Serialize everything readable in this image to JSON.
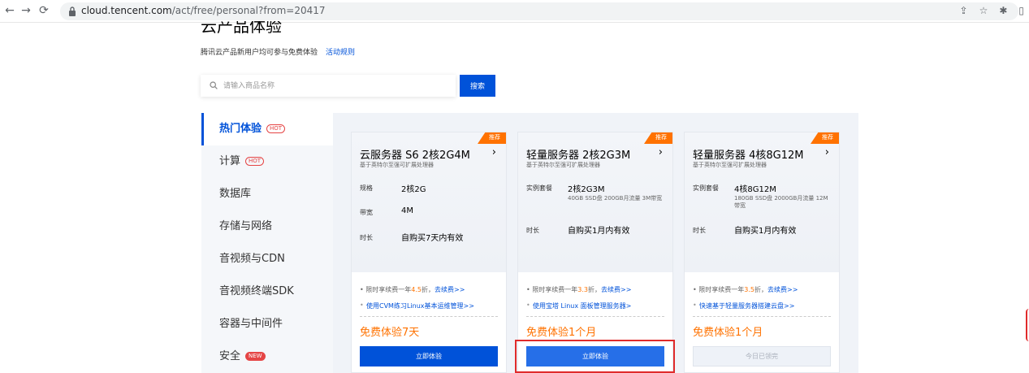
{
  "browser": {
    "url_host": "cloud.tencent.com",
    "url_path": "/act/free/personal?from=20417"
  },
  "page": {
    "title": "云产品体验",
    "subtitle": "腾讯云产品新用户均可参与免费体验",
    "rules_link": "活动规则"
  },
  "search": {
    "placeholder": "请输入商品名称",
    "button": "搜索"
  },
  "sidebar": {
    "items": [
      {
        "label": "热门体验",
        "badge": "HOT"
      },
      {
        "label": "计算",
        "badge": "HOT"
      },
      {
        "label": "数据库"
      },
      {
        "label": "存储与网络"
      },
      {
        "label": "音视频与CDN"
      },
      {
        "label": "音视频终端SDK"
      },
      {
        "label": "容器与中间件"
      },
      {
        "label": "安全",
        "badge": "NEW"
      }
    ]
  },
  "cards": [
    {
      "tag": "推荐",
      "title": "云服务器 S6 2核2G4M",
      "arrow": "›",
      "desc": "基于英特尔至强可扩展处理器",
      "spec1_label": "规格",
      "spec1_value": "2核2G",
      "spec2_label": "带宽",
      "spec2_value": "4M",
      "spec3_label": "时长",
      "spec3_value": "自购买7天内有效",
      "bullet1_pre": "限时享续费一年",
      "bullet1_num": "4.5",
      "bullet1_post": "折，",
      "bullet1_link": "去续费>>",
      "bullet2": "使用CVM练习Linux基本运维管理>>",
      "free": "免费体验7天",
      "button": "立即体验"
    },
    {
      "tag": "推荐",
      "title": "轻量服务器 2核2G3M",
      "arrow": "›",
      "desc": "基于英特尔至强可扩展处理器",
      "spec1_label": "实例套餐",
      "spec1_value": "2核2G3M",
      "spec1_sub": "40GB SSD盘 200GB月流量 3M带宽",
      "spec3_label": "时长",
      "spec3_value": "自购买1月内有效",
      "bullet1_pre": "限时享续费一年",
      "bullet1_num": "3.3",
      "bullet1_post": "折，",
      "bullet1_link": "去续费>>",
      "bullet2": "使用宝塔 Linux 面板管理服务器>",
      "free": "免费体验1个月",
      "button": "立即体验"
    },
    {
      "tag": "推荐",
      "title": "轻量服务器 4核8G12M",
      "arrow": "›",
      "desc": "基于英特尔至强可扩展处理器",
      "spec1_label": "实例套餐",
      "spec1_value": "4核8G12M",
      "spec1_sub": "180GB SSD盘 2000GB月流量 12M带宽",
      "spec3_label": "时长",
      "spec3_value": "自购买1月内有效",
      "bullet1_pre": "限时享续费一年",
      "bullet1_num": "3.5",
      "bullet1_post": "折，",
      "bullet1_link": "去续费>>",
      "bullet2": "快速基于轻量服务器搭建云盘>>",
      "free": "免费体验1个月",
      "button": "今日已领完"
    }
  ],
  "colors": {
    "accent": "#0052d9",
    "orange": "#ff7200",
    "highlight": "#e02b2b"
  }
}
